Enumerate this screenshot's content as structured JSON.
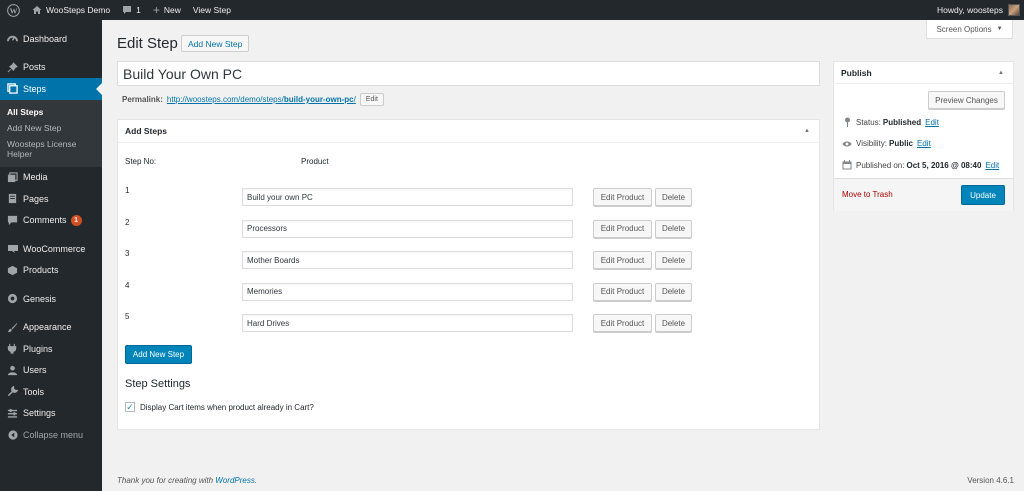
{
  "adminbar": {
    "site_name": "WooSteps Demo",
    "comments_count": "1",
    "new_label": "New",
    "view_label": "View Step",
    "howdy": "Howdy, woosteps"
  },
  "sidebar": {
    "items": [
      {
        "label": "Dashboard",
        "icon": "dashboard-icon"
      },
      {
        "label": "Posts",
        "icon": "pin-icon"
      },
      {
        "label": "Steps",
        "icon": "steps-icon"
      },
      {
        "label": "Media",
        "icon": "media-icon"
      },
      {
        "label": "Pages",
        "icon": "page-icon"
      },
      {
        "label": "Comments",
        "icon": "comment-icon",
        "badge": "1"
      },
      {
        "label": "WooCommerce",
        "icon": "woocommerce-icon"
      },
      {
        "label": "Products",
        "icon": "products-icon"
      },
      {
        "label": "Genesis",
        "icon": "genesis-icon"
      },
      {
        "label": "Appearance",
        "icon": "brush-icon"
      },
      {
        "label": "Plugins",
        "icon": "plugin-icon"
      },
      {
        "label": "Users",
        "icon": "user-icon"
      },
      {
        "label": "Tools",
        "icon": "wrench-icon"
      },
      {
        "label": "Settings",
        "icon": "settings-icon"
      },
      {
        "label": "Collapse menu",
        "icon": "collapse-icon"
      }
    ],
    "submenu": [
      "All Steps",
      "Add New Step",
      "Woosteps License Helper"
    ]
  },
  "header": {
    "screen_options": "Screen Options",
    "title": "Edit Step",
    "add_new": "Add New Step"
  },
  "post": {
    "title": "Build Your Own PC",
    "permalink_label": "Permalink:",
    "permalink_base": "http://woosteps.com/demo/steps/",
    "permalink_slug": "build-your-own-pc",
    "permalink_end": "/",
    "permalink_edit": "Edit"
  },
  "steps_box": {
    "title": "Add Steps",
    "col_step": "Step No:",
    "col_product": "Product",
    "edit_label": "Edit Product",
    "delete_label": "Delete",
    "rows": [
      {
        "num": "1",
        "product": "Build your own PC"
      },
      {
        "num": "2",
        "product": "Processors"
      },
      {
        "num": "3",
        "product": "Mother Boards"
      },
      {
        "num": "4",
        "product": "Memories"
      },
      {
        "num": "5",
        "product": "Hard Drives"
      }
    ],
    "add_new_step": "Add New Step",
    "settings_title": "Step Settings",
    "cart_option": "Display Cart items when product already in Cart?",
    "cart_checked": true
  },
  "publish": {
    "title": "Publish",
    "preview": "Preview Changes",
    "status_label": "Status:",
    "status_value": "Published",
    "visibility_label": "Visibility:",
    "visibility_value": "Public",
    "published_label": "Published on:",
    "published_value": "Oct 5, 2016 @ 08:40",
    "edit": "Edit",
    "trash": "Move to Trash",
    "update": "Update"
  },
  "footer": {
    "thanks": "Thank you for creating with ",
    "wp_link": "WordPress",
    "thanks_end": ".",
    "version": "Version 4.6.1"
  },
  "colors": {
    "primary": "#0085ba",
    "sidebar_bg": "#23282d",
    "current_menu": "#0073aa",
    "badge": "#d54e21"
  }
}
